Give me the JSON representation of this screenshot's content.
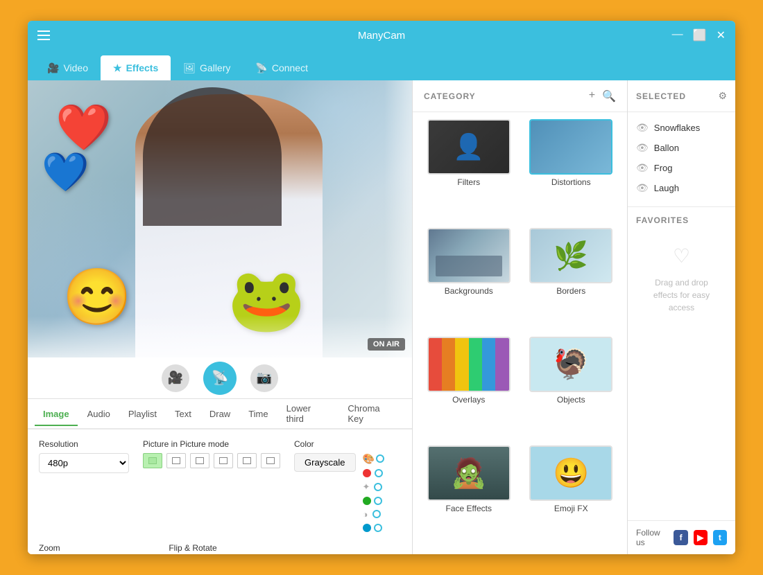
{
  "window": {
    "title": "ManyCam"
  },
  "titlebar": {
    "minimize": "—",
    "maximize": "⬜",
    "close": "✕"
  },
  "nav": {
    "tabs": [
      {
        "id": "video",
        "label": "Video",
        "icon": "🎥",
        "active": false
      },
      {
        "id": "effects",
        "label": "Effects",
        "icon": "★",
        "active": true
      },
      {
        "id": "gallery",
        "label": "Gallery",
        "icon": "🖼",
        "active": false
      },
      {
        "id": "connect",
        "label": "Connect",
        "icon": "📡",
        "active": false
      }
    ]
  },
  "category": {
    "header": "CATEGORY",
    "add_icon": "+",
    "search_icon": "🔍",
    "items": [
      {
        "id": "filters",
        "label": "Filters"
      },
      {
        "id": "distortions",
        "label": "Distortions"
      },
      {
        "id": "backgrounds",
        "label": "Backgrounds"
      },
      {
        "id": "borders",
        "label": "Borders"
      },
      {
        "id": "overlays",
        "label": "Overlays"
      },
      {
        "id": "objects",
        "label": "Objects"
      },
      {
        "id": "face1",
        "label": "Face Effects"
      },
      {
        "id": "face2",
        "label": "Emoji FX"
      }
    ]
  },
  "selected": {
    "header": "SELECTED",
    "items": [
      {
        "label": "Snowflakes"
      },
      {
        "label": "Ballon"
      },
      {
        "label": "Frog"
      },
      {
        "label": "Laugh"
      }
    ]
  },
  "favorites": {
    "header": "FAVORITES",
    "empty_text": "Drag and drop effects for easy access"
  },
  "social": {
    "follow_text": "Follow us"
  },
  "bottom_tabs": [
    {
      "id": "image",
      "label": "Image",
      "active": true
    },
    {
      "id": "audio",
      "label": "Audio",
      "active": false
    },
    {
      "id": "playlist",
      "label": "Playlist",
      "active": false
    },
    {
      "id": "text",
      "label": "Text",
      "active": false
    },
    {
      "id": "draw",
      "label": "Draw",
      "active": false
    },
    {
      "id": "time",
      "label": "Time",
      "active": false
    },
    {
      "id": "lower_third",
      "label": "Lower third",
      "active": false
    },
    {
      "id": "chroma_key",
      "label": "Chroma Key",
      "active": false
    }
  ],
  "settings": {
    "resolution_label": "Resolution",
    "resolution_value": "480p",
    "pip_label": "Picture in Picture mode",
    "color_label": "Color",
    "grayscale_btn": "Grayscale",
    "zoom_label": "Zoom",
    "flip_rotate_label": "Flip & Rotate"
  },
  "on_air": "ON AIR",
  "stream_icon": "📡"
}
